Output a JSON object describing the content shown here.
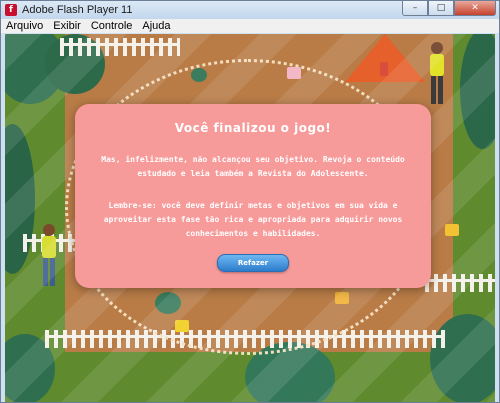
{
  "window": {
    "title": "Adobe Flash Player 11",
    "app_icon_glyph": "f",
    "controls": {
      "minimize": "–",
      "maximize": "□",
      "close": "✕"
    }
  },
  "menubar": {
    "items": [
      "Arquivo",
      "Exibir",
      "Controle",
      "Ajuda"
    ]
  },
  "modal": {
    "title": "Você finalizou o jogo!",
    "paragraph1": "Mas, infelizmente, não alcançou seu objetivo. Revoja o conteúdo estudado e leia também a Revista do Adolescente.",
    "paragraph2": "Lembre-se: você deve definir metas e objetivos em sua vida e aproveitar esta fase tão rica e apropriada para adquirir novos conhecimentos e habilidades.",
    "button_label": "Refazer"
  },
  "colors": {
    "modal_bg": "#f79a9a",
    "button": "#3b8ad9",
    "ground": "#b97c47",
    "tree": "#2f6f4f",
    "tent": "#e6602b"
  }
}
